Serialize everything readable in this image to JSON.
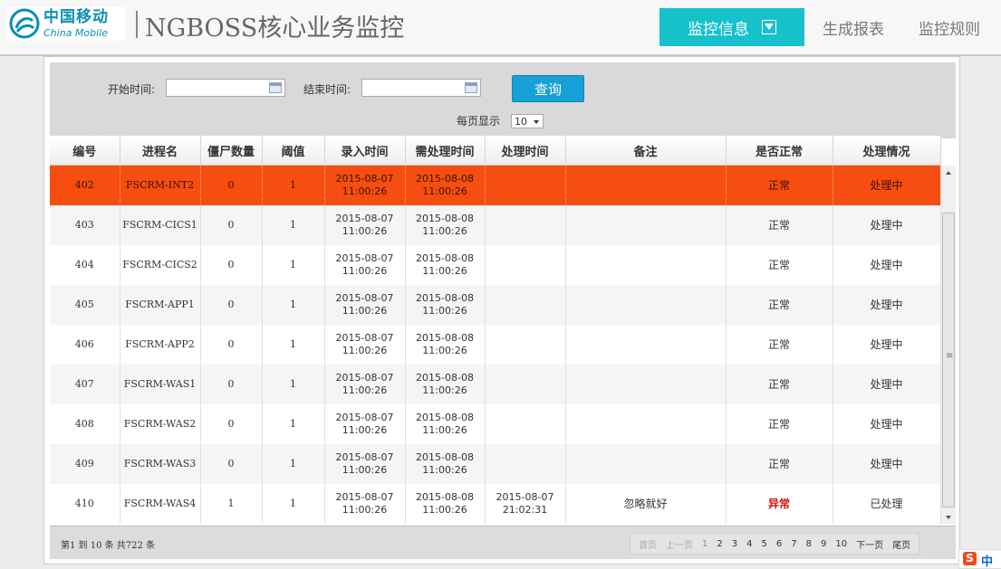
{
  "header": {
    "logo_cn": "中国移动",
    "logo_en": "China Mobile",
    "title": "NGBOSS核心业务监控",
    "nav": {
      "active": "监控信息",
      "reports": "生成报表",
      "rules": "监控规则"
    }
  },
  "filter": {
    "start_label": "开始时间:",
    "start_value": "",
    "end_label": "结束时间:",
    "end_value": "",
    "query_label": "查询",
    "per_page_label": "每页显示",
    "per_page_value": "10"
  },
  "table": {
    "columns": [
      "编号",
      "进程名",
      "僵尸数量",
      "阈值",
      "录入时间",
      "需处理时间",
      "处理时间",
      "备注",
      "是否正常",
      "处理情况"
    ],
    "rows": [
      {
        "id": "402",
        "process": "FSCRM-INT2",
        "zombies": "0",
        "threshold": "1",
        "entry_time": "2015-08-07 11:00:26",
        "due_time": "2015-08-08 11:00:26",
        "handled_time": "",
        "remark": "",
        "normal": "正常",
        "status": "处理中"
      },
      {
        "id": "403",
        "process": "FSCRM-CICS1",
        "zombies": "0",
        "threshold": "1",
        "entry_time": "2015-08-07 11:00:26",
        "due_time": "2015-08-08 11:00:26",
        "handled_time": "",
        "remark": "",
        "normal": "正常",
        "status": "处理中"
      },
      {
        "id": "404",
        "process": "FSCRM-CICS2",
        "zombies": "0",
        "threshold": "1",
        "entry_time": "2015-08-07 11:00:26",
        "due_time": "2015-08-08 11:00:26",
        "handled_time": "",
        "remark": "",
        "normal": "正常",
        "status": "处理中"
      },
      {
        "id": "405",
        "process": "FSCRM-APP1",
        "zombies": "0",
        "threshold": "1",
        "entry_time": "2015-08-07 11:00:26",
        "due_time": "2015-08-08 11:00:26",
        "handled_time": "",
        "remark": "",
        "normal": "正常",
        "status": "处理中"
      },
      {
        "id": "406",
        "process": "FSCRM-APP2",
        "zombies": "0",
        "threshold": "1",
        "entry_time": "2015-08-07 11:00:26",
        "due_time": "2015-08-08 11:00:26",
        "handled_time": "",
        "remark": "",
        "normal": "正常",
        "status": "处理中"
      },
      {
        "id": "407",
        "process": "FSCRM-WAS1",
        "zombies": "0",
        "threshold": "1",
        "entry_time": "2015-08-07 11:00:26",
        "due_time": "2015-08-08 11:00:26",
        "handled_time": "",
        "remark": "",
        "normal": "正常",
        "status": "处理中"
      },
      {
        "id": "408",
        "process": "FSCRM-WAS2",
        "zombies": "0",
        "threshold": "1",
        "entry_time": "2015-08-07 11:00:26",
        "due_time": "2015-08-08 11:00:26",
        "handled_time": "",
        "remark": "",
        "normal": "正常",
        "status": "处理中"
      },
      {
        "id": "409",
        "process": "FSCRM-WAS3",
        "zombies": "0",
        "threshold": "1",
        "entry_time": "2015-08-07 11:00:26",
        "due_time": "2015-08-08 11:00:26",
        "handled_time": "",
        "remark": "",
        "normal": "正常",
        "status": "处理中"
      },
      {
        "id": "410",
        "process": "FSCRM-WAS4",
        "zombies": "1",
        "threshold": "1",
        "entry_time": "2015-08-07 11:00:26",
        "due_time": "2015-08-08 11:00:26",
        "handled_time": "2015-08-07 21:02:31",
        "remark": "忽略就好",
        "normal": "异常",
        "status": "已处理"
      }
    ]
  },
  "footer": {
    "total_text": "第1 到 10 条 共722 条",
    "pager": {
      "first": "首页",
      "prev": "上一页",
      "pages": [
        "1",
        "2",
        "3",
        "4",
        "5",
        "6",
        "7",
        "8",
        "9",
        "10"
      ],
      "current": "1",
      "next": "下一页",
      "last": "尾页"
    }
  },
  "ime": {
    "logo": "S",
    "mode": "中"
  },
  "colors": {
    "accent": "#16c1cc",
    "query_button": "#16a2d6",
    "selected_row": "#f54e10",
    "abnormal_text": "#d01010"
  }
}
